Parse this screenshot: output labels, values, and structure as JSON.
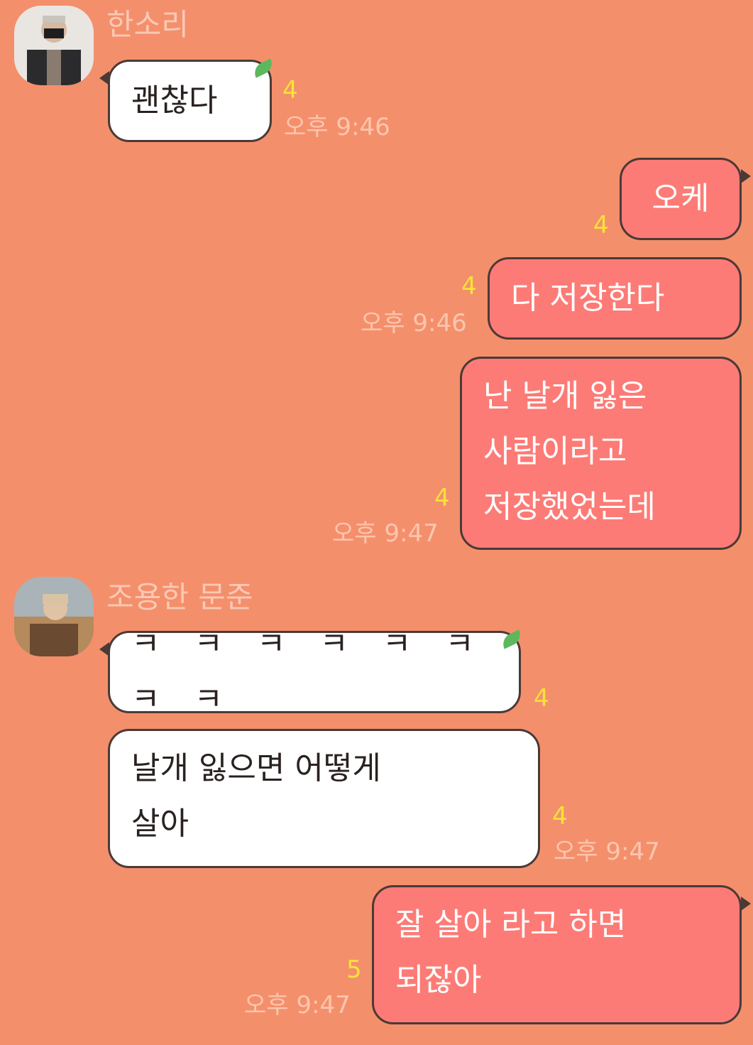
{
  "colors": {
    "background": "#f48f6c",
    "incoming_bubble": "#ffffff",
    "outgoing_bubble": "#fd7b76",
    "unread_count": "#f7e23a",
    "timestamp": "#fbc6ad",
    "sender_name": "#fac9b4"
  },
  "senders": {
    "first": {
      "name": "한소리",
      "avatar_icon": "profile-photo"
    },
    "second": {
      "name": "조용한 문준",
      "avatar_icon": "profile-photo"
    }
  },
  "messages": {
    "m1": {
      "text": "괜찮다",
      "unread": "4",
      "time": "오후 9:46"
    },
    "m2": {
      "text": "오케",
      "unread": "4"
    },
    "m3": {
      "text": "다 저장한다",
      "unread": "4",
      "time": "오후 9:46"
    },
    "m4": {
      "lines": [
        "난 날개 잃은",
        "사람이라고",
        "저장했었는데"
      ],
      "unread": "4",
      "time": "오후 9:47"
    },
    "m5": {
      "text": "ㅋ ㅋ ㅋ ㅋ ㅋ ㅋ ㅋ ㅋ",
      "unread": "4"
    },
    "m6": {
      "lines": [
        "날개 잃으면 어떻게",
        "살아"
      ],
      "unread": "4",
      "time": "오후 9:47"
    },
    "m7": {
      "lines": [
        "잘 살아 라고 하면",
        "되잖아"
      ],
      "unread": "5",
      "time": "오후 9:47"
    }
  }
}
